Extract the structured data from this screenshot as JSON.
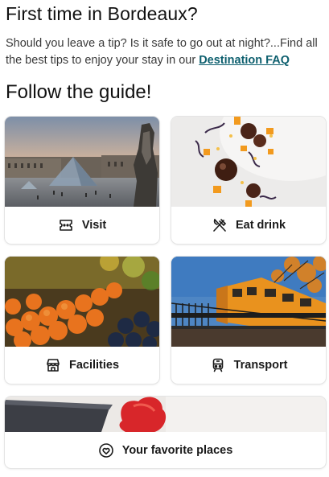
{
  "header": {
    "title": "First time in Bordeaux?",
    "intro_text": "Should you leave a tip? Is it safe to go out at night?...Find all the best tips to enjoy your stay in our ",
    "intro_link": "Destination FAQ"
  },
  "guide": {
    "title": "Follow the guide!",
    "cards": [
      {
        "label": "Visit",
        "icon": "ticket-icon"
      },
      {
        "label": "Eat drink",
        "icon": "fork-knife-icon"
      },
      {
        "label": "Facilities",
        "icon": "shop-icon"
      },
      {
        "label": "Transport",
        "icon": "train-icon"
      }
    ],
    "favorites": {
      "label": "Your favorite places",
      "icon": "heart-icon"
    }
  },
  "colors": {
    "link": "#0d5f6e",
    "text": "#1a1a1a"
  }
}
